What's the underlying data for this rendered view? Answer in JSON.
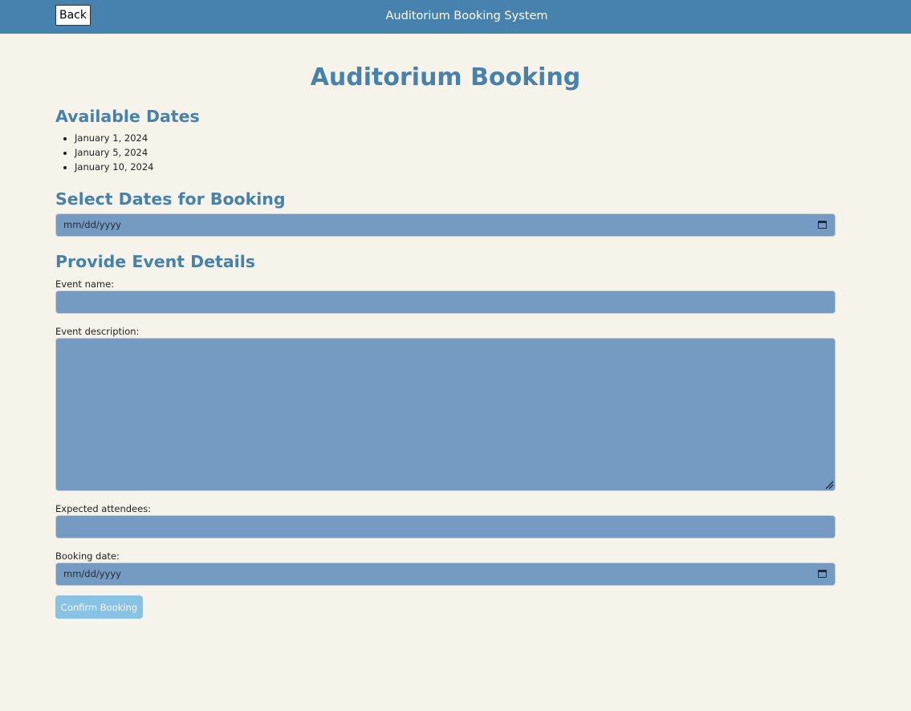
{
  "header": {
    "back_label": "Back",
    "title": "Auditorium Booking System"
  },
  "page": {
    "title": "Auditorium Booking"
  },
  "available_dates": {
    "heading": "Available Dates",
    "items": [
      "January 1, 2024",
      "January 5, 2024",
      "January 10, 2024"
    ]
  },
  "select_dates": {
    "heading": "Select Dates for Booking",
    "placeholder": "mm/dd/yyyy"
  },
  "event_details": {
    "heading": "Provide Event Details",
    "event_name_label": "Event name:",
    "event_name_value": "",
    "event_description_label": "Event description:",
    "event_description_value": "",
    "attendees_label": "Expected attendees:",
    "attendees_value": "",
    "booking_date_label": "Booking date:",
    "booking_date_placeholder": "mm/dd/yyyy"
  },
  "actions": {
    "confirm_label": "Confirm Booking"
  },
  "colors": {
    "header_bg": "#4682ad",
    "heading": "#4682ad",
    "input_bg": "#759bc3",
    "button_bg": "#88c3e6",
    "page_bg": "#f6f3eb"
  },
  "icons": {
    "date_picker": "calendar-icon",
    "textarea_resize": "resize-handle-icon"
  }
}
